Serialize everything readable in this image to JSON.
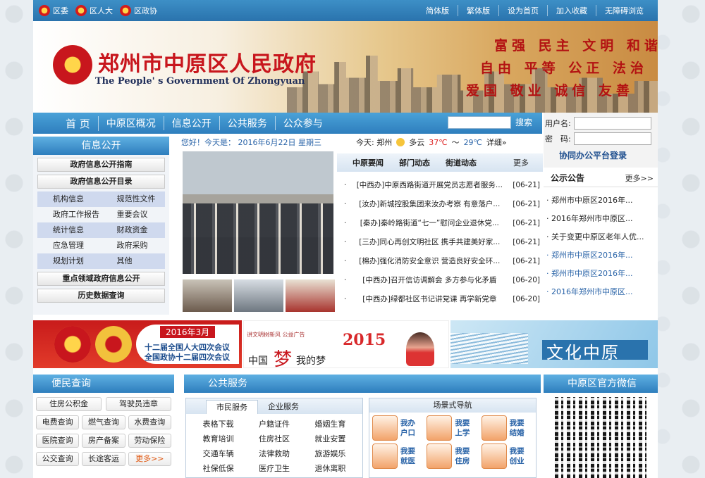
{
  "topbar": {
    "left": [
      "区委",
      "区人大",
      "区政协"
    ],
    "right": [
      "简体版",
      "繁体版",
      "设为首页",
      "加入收藏",
      "无障碍浏览"
    ]
  },
  "banner": {
    "title_cn": "郑州市中原区人民政府",
    "title_en": "The People' s Government Of Zhongyuan",
    "slogan1": "富强 民主 文明 和谐",
    "slogan2": "自由 平等 公正 法治",
    "slogan3": "爱国 敬业 诚信 友善"
  },
  "nav": {
    "items": [
      "首 页",
      "中原区概况",
      "信息公开",
      "公共服务",
      "公众参与"
    ],
    "search_label": "搜索"
  },
  "login": {
    "username_label": "用户名:",
    "password_label": "密　码:",
    "button": "协同办公平台登录"
  },
  "info": {
    "title": "信息公开",
    "btn1": "政府信息公开指南",
    "btn2": "政府信息公开目录",
    "grid": [
      "机构信息",
      "规范性文件",
      "政府工作报告",
      "重要会议",
      "统计信息",
      "财政资金",
      "应急管理",
      "政府采购",
      "规划计划",
      "其他"
    ],
    "btn3": "重点领域政府信息公开",
    "btn4": "历史数据查询"
  },
  "date_line": "您好！今天是： 2016年6月22日 星期三",
  "weather": {
    "label": "今天: 郑州",
    "cond": "多云",
    "temp_hi": "37℃",
    "temp_sep": "～",
    "temp_lo": "29℃",
    "detail": "详细»"
  },
  "news_tabs": [
    "中原要闻",
    "部门动态",
    "街道动态"
  ],
  "news_more": "更多",
  "news": [
    {
      "title": "[中西办]中原西路街道开展党员志愿者服务...",
      "date": "[06-21]"
    },
    {
      "title": "[汝办]新城控股集团来汝办考察 有意落户...",
      "date": "[06-21]"
    },
    {
      "title": "[秦办]秦岭路街道“七一”慰问企业退休党...",
      "date": "[06-21]"
    },
    {
      "title": "[三办]同心再创文明社区 携手共建美好家...",
      "date": "[06-21]"
    },
    {
      "title": "[棉办]强化消防安全意识 营造良好安全环...",
      "date": "[06-21]"
    },
    {
      "title": "[中西办]召开信访调解会 多方参与化矛盾",
      "date": "[06-20]"
    },
    {
      "title": "[中西办]绿都社区书记讲党课 再学新党章",
      "date": "[06-20]"
    }
  ],
  "announce": {
    "title": "公示公告",
    "more": "更多>>",
    "items": [
      {
        "text": "郑州市中原区2016年...",
        "blue": false
      },
      {
        "text": "2016年郑州市中原区...",
        "blue": false
      },
      {
        "text": "关于变更中原区老年人优...",
        "blue": false
      },
      {
        "text": "郑州市中原区2016年...",
        "blue": true
      },
      {
        "text": "郑州市中原区2016年...",
        "blue": true
      },
      {
        "text": "2016年郑州市中原区...",
        "blue": true
      }
    ]
  },
  "banners": {
    "b1_date": "2016年3月",
    "b1_line1": "十二届全国人大四次会议",
    "b1_line2": "全国政协十二届四次会议",
    "b2_top": "讲文明树新风 公益广告",
    "b2_year": "2015",
    "b2_left": "中国",
    "b2_mid": "梦",
    "b2_right": "我的梦",
    "b3_text": "文化中原"
  },
  "convenience": {
    "title": "便民查询",
    "top": [
      "住房公积金",
      "驾驶员违章"
    ],
    "grid": [
      "电费查询",
      "燃气查询",
      "水费查询",
      "医院查询",
      "房产备案",
      "劳动保险",
      "公交查询",
      "长途客运",
      "更多>>"
    ]
  },
  "service": {
    "title": "公共服务",
    "tabs": [
      "市民服务",
      "企业服务"
    ],
    "grid": [
      "表格下载",
      "户籍证件",
      "婚姻生育",
      "教育培训",
      "住房社区",
      "就业安置",
      "交通车辆",
      "法律救助",
      "旅游娱乐",
      "社保低保",
      "医疗卫生",
      "退休离职"
    ],
    "scene_title": "场景式导航",
    "scene": [
      "我办户口",
      "我要上学",
      "我要结婚",
      "我要就医",
      "我要住房",
      "我要创业"
    ]
  },
  "wechat": {
    "title": "中原区官方微信"
  }
}
